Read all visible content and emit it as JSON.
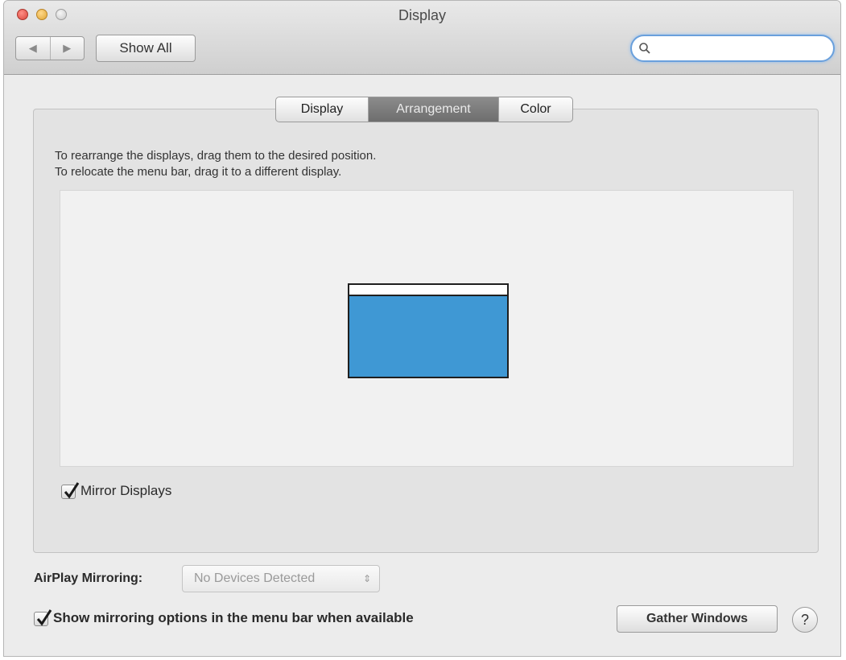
{
  "window": {
    "title": "Display"
  },
  "toolbar": {
    "back_glyph": "◀",
    "forward_glyph": "▶",
    "show_all_label": "Show All",
    "search": {
      "value": "",
      "placeholder": ""
    }
  },
  "tabs": [
    {
      "label": "Display",
      "selected": false
    },
    {
      "label": "Arrangement",
      "selected": true
    },
    {
      "label": "Color",
      "selected": false
    }
  ],
  "arrangement": {
    "instruction_line1": "To rearrange the displays, drag them to the desired position.",
    "instruction_line2": "To relocate the menu bar, drag it to a different display.",
    "display_color": "#3f98d4"
  },
  "mirror_displays": {
    "label": "Mirror Displays",
    "checked": true
  },
  "airplay": {
    "label": "AirPlay Mirroring:",
    "selected_value": "No Devices Detected",
    "enabled": false
  },
  "show_mirroring_options": {
    "label": "Show mirroring options in the menu bar when available",
    "checked": true
  },
  "gather_windows_label": "Gather Windows",
  "help_glyph": "?",
  "icons": [
    "close-icon",
    "minimize-icon",
    "zoom-icon",
    "back-icon",
    "forward-icon",
    "search-icon",
    "checkmark-icon",
    "updown-icon",
    "help-icon"
  ]
}
